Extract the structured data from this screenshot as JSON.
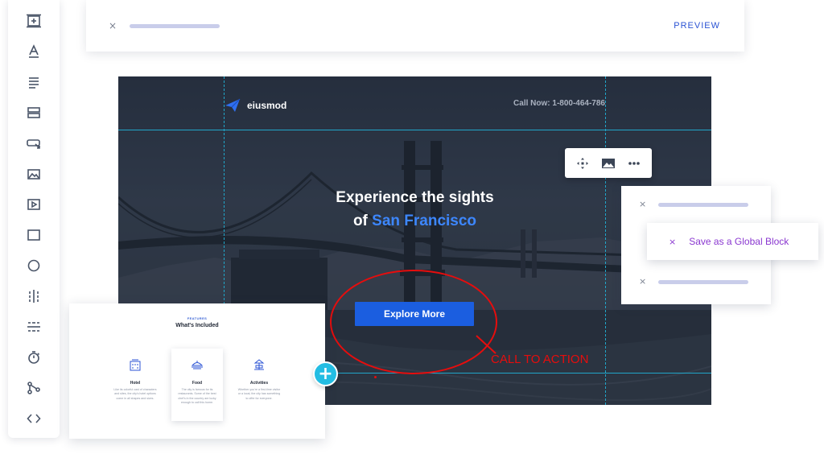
{
  "top_bar": {
    "close_glyph": "×",
    "preview_label": "PREVIEW"
  },
  "left_toolbar": {
    "tools": [
      "add-section-icon",
      "text-icon",
      "paragraph-icon",
      "columns-icon",
      "button-icon",
      "image-icon",
      "video-icon",
      "rectangle-icon",
      "circle-icon",
      "column-divider-icon",
      "row-divider-icon",
      "timer-icon",
      "share-icon",
      "code-icon"
    ]
  },
  "hero": {
    "logo_text": "eiusmod",
    "call_now": "Call Now: 1-800-464-786",
    "headline_line1": "Experience the sights",
    "headline_line2_prefix": "of ",
    "headline_line2_accent": "San Francisco",
    "cta_label": "Explore More",
    "accent_color": "#3d87ff",
    "cta_color": "#1b5ee0",
    "guide_color": "#21a6c9"
  },
  "mini_toolbar": {
    "icons": [
      "move-icon",
      "image-icon",
      "more-icon"
    ]
  },
  "annotation": {
    "label": "CALL TO ACTION",
    "color": "#e60d0d"
  },
  "right_panel": {
    "close_glyph": "×",
    "global_block": {
      "close_glyph": "×",
      "label": "Save as a Global Block",
      "color": "#8a37d0"
    }
  },
  "features_card": {
    "tag": "FEATURES",
    "title": "What's Included",
    "items": [
      {
        "icon": "hotel-icon",
        "title": "Hotel",
        "desc": "Like its colorful cast of characters and sites, the city's hotel options come in all shapes and sizes."
      },
      {
        "icon": "food-icon",
        "title": "Food",
        "desc": "The city is famous for its restaurants. Some of the best chef's in the country are lucky enough to call this home."
      },
      {
        "icon": "activities-icon",
        "title": "Activities",
        "desc": "Whether you're a first-time visitor or a local, the city has something to offer for everyone."
      }
    ],
    "add_glyph": "+"
  }
}
